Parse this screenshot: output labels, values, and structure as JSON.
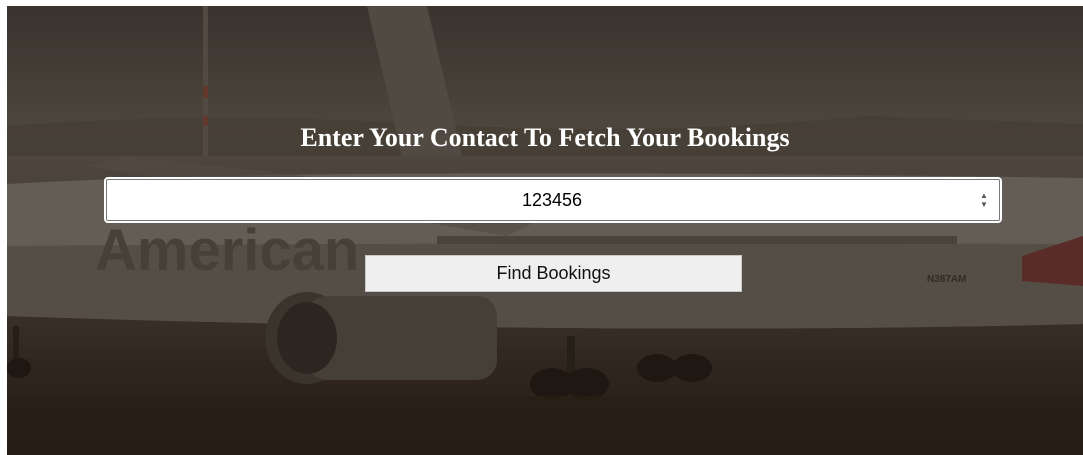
{
  "page": {
    "heading": "Enter Your Contact To Fetch Your Bookings",
    "background_image": "american-airlines-plane-on-tarmac",
    "accent_color": "#ffffff"
  },
  "contact_input": {
    "value": "123456",
    "type": "number"
  },
  "find_button": {
    "label": "Find Bookings"
  },
  "background_livery": {
    "airline_name": "American",
    "registration": "N387AM"
  }
}
